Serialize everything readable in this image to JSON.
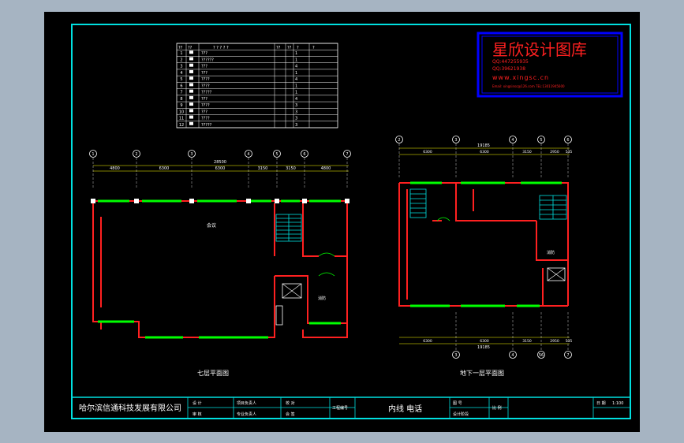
{
  "colors": {
    "background": "#a6b4c2",
    "sheet": "#000000",
    "frame": "#00e0e0",
    "wall": "#ff2020",
    "window": "#00ff00",
    "dimension": "#ffff00",
    "text": "#ffffff",
    "watermark_border": "#0000ff",
    "watermark_text": "#ff2020"
  },
  "watermark": {
    "title": "星欣设计图库",
    "qq1": "QQ:447255935",
    "qq2": "QQ:39621938",
    "url": "www.xingsc.cn",
    "email": "Email: xingsinsc@126.com  TEL:13011945600"
  },
  "legend": {
    "header": [
      "??",
      "??",
      "? ? ? ? ?",
      "??",
      "??",
      "?",
      "?"
    ],
    "rows": [
      {
        "num": "1",
        "desc": "???",
        "qty": "1"
      },
      {
        "num": "2",
        "desc": "??????",
        "qty": "1"
      },
      {
        "num": "3",
        "desc": "???",
        "qty": "4"
      },
      {
        "num": "4",
        "desc": "???",
        "qty": "1"
      },
      {
        "num": "5",
        "desc": "????",
        "qty": "4"
      },
      {
        "num": "6",
        "desc": "????",
        "qty": "1"
      },
      {
        "num": "7",
        "desc": "?????",
        "qty": "1"
      },
      {
        "num": "8",
        "desc": "???",
        "qty": "4"
      },
      {
        "num": "9",
        "desc": "????",
        "qty": "3"
      },
      {
        "num": "10",
        "desc": "???",
        "qty": "3"
      },
      {
        "num": "11",
        "desc": "????",
        "qty": "3"
      },
      {
        "num": "12",
        "desc": "?????",
        "qty": "3"
      }
    ]
  },
  "plan_left": {
    "axes": [
      "1",
      "2",
      "3",
      "4",
      "5",
      "6",
      "7"
    ],
    "total_dim": "28500",
    "segment_dims": [
      "4800",
      "6300",
      "6300",
      "3150",
      "3150",
      "4800"
    ],
    "room_label": "会议",
    "side_label": "消防",
    "title": "七层平面图"
  },
  "plan_right": {
    "axes_top": [
      "2",
      "3",
      "4",
      "5",
      "6"
    ],
    "total_dim_top": "19185",
    "dims_top": [
      "6300",
      "6300",
      "3150",
      "2950",
      "535"
    ],
    "axes_bottom": [
      "3",
      "4",
      "56",
      "7"
    ],
    "dims_bottom": [
      "6300",
      "6300",
      "3150",
      "2950",
      "535"
    ],
    "total_dim_bottom": "19185",
    "room_label": "消防",
    "title": "地下一层平面图"
  },
  "title_block": {
    "company": "哈尔滨信通科技发展有限公司",
    "drawing_name": "内线 电话",
    "cells": [
      "设 计",
      "审 核",
      "项目负责人",
      "专业负责人",
      "校 对",
      "会 签",
      "工程编号",
      "图 号",
      "设计阶段",
      "比 例",
      "日 期",
      "1:100"
    ]
  }
}
